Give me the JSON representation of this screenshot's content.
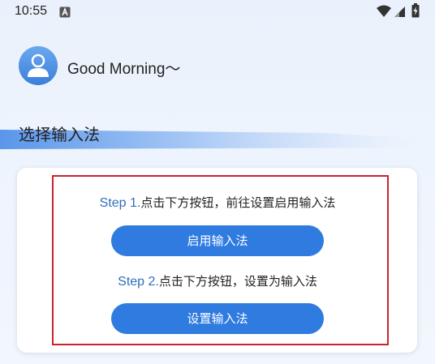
{
  "status_bar": {
    "time": "10:55",
    "notification_icon": "a-notification-icon",
    "wifi_icon": "wifi-icon",
    "signal_icon": "cell-signal-icon",
    "battery_icon": "battery-charging-icon"
  },
  "header": {
    "avatar_icon": "user-avatar-icon",
    "greeting": "Good Morning～"
  },
  "section": {
    "title": "选择输入法"
  },
  "steps": [
    {
      "number": "Step 1.",
      "text": "点击下方按钮，前往设置启用输入法",
      "button_label": "启用输入法"
    },
    {
      "number": "Step 2.",
      "text": "点击下方按钮，设置为输入法",
      "button_label": "设置输入法"
    }
  ],
  "colors": {
    "accent": "#2f7be0",
    "step_number": "#2f6fbd",
    "highlight_border": "#c9242b",
    "background": "#eef4fd"
  }
}
